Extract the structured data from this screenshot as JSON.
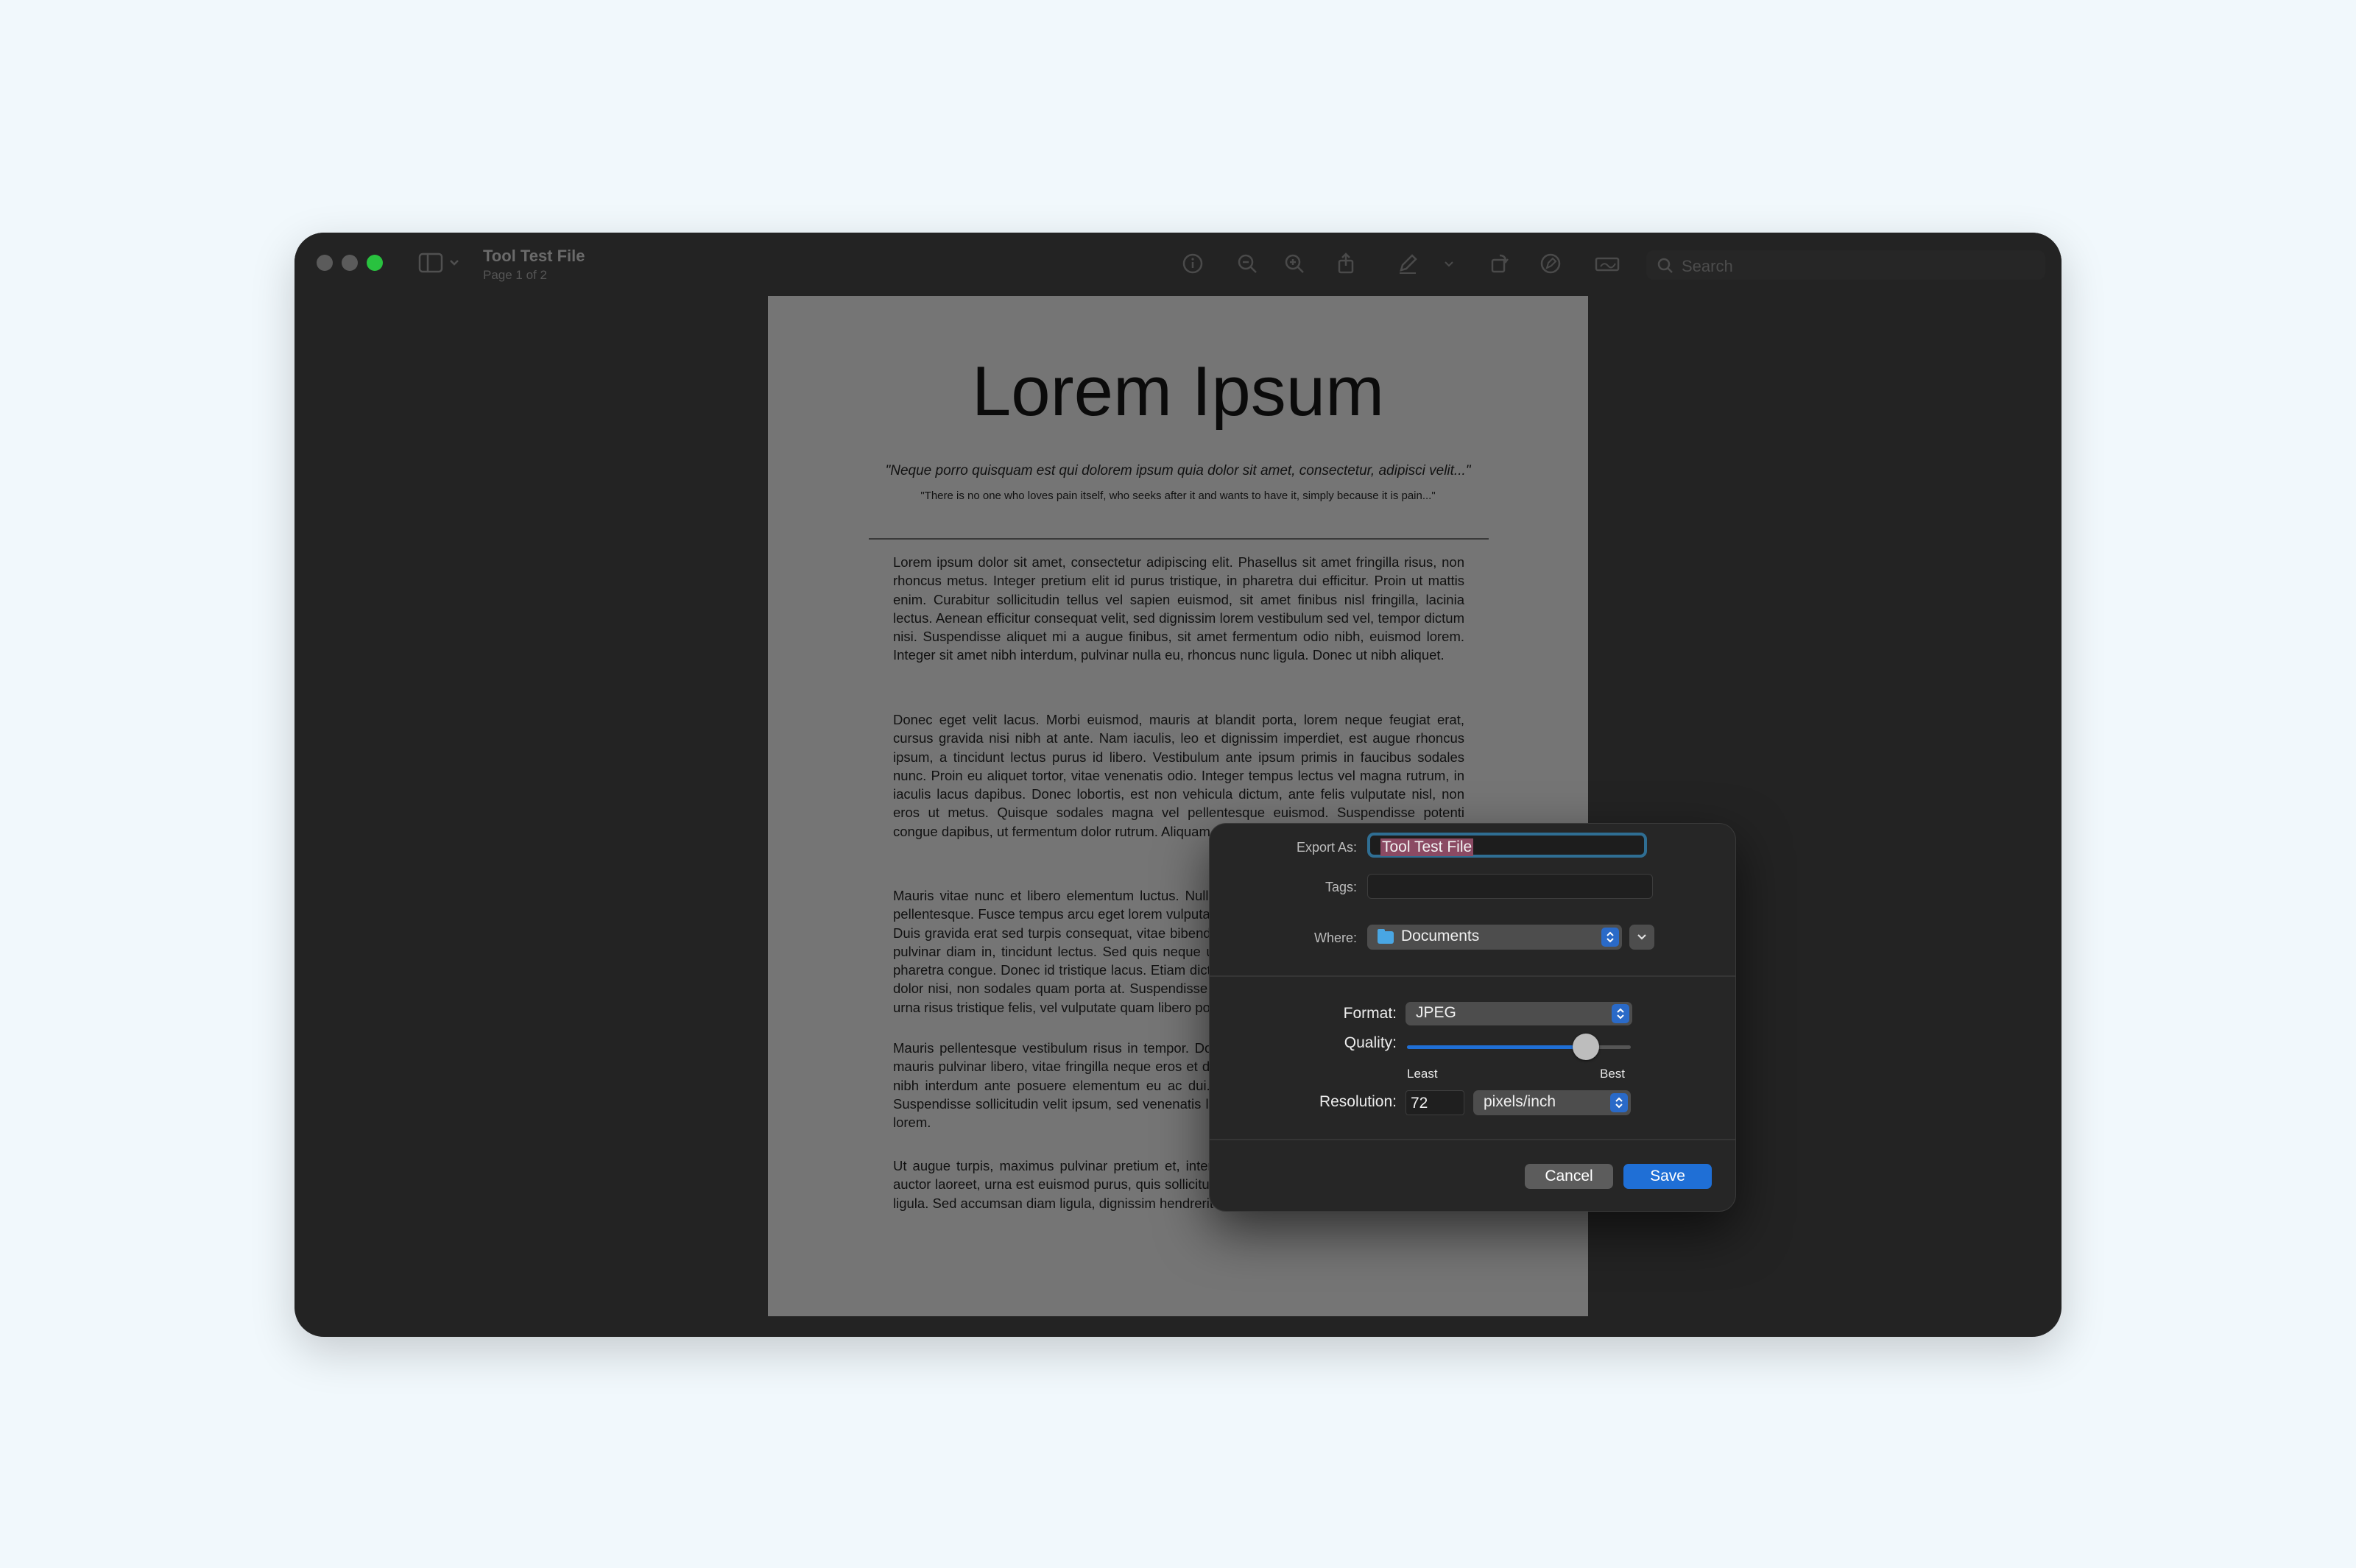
{
  "window": {
    "title": "Tool Test File",
    "subtitle": "Page 1 of 2",
    "search_placeholder": "Search",
    "toolbar_icons": [
      "info-icon",
      "zoom-out-icon",
      "zoom-in-icon",
      "share-icon",
      "markup-pen-icon",
      "chevron-down-icon",
      "rotate-icon",
      "highlight-circle-icon",
      "sign-icon",
      "search-icon"
    ]
  },
  "document": {
    "heading": "Lorem Ipsum",
    "quote": "\"Neque porro quisquam est qui dolorem ipsum quia dolor sit amet, consectetur, adipisci velit...\"",
    "quote_translation": "\"There is no one who loves pain itself, who seeks after it and wants to have it, simply because it is pain...\"",
    "paragraphs": [
      "Lorem ipsum dolor sit amet, consectetur adipiscing elit. Phasellus sit amet fringilla risus, non rhoncus metus. Integer pretium elit id purus tristique, in pharetra dui efficitur. Proin ut mattis enim. Curabitur sollicitudin tellus vel sapien euismod, sit amet finibus nisl fringilla, lacinia lectus. Aenean efficitur consequat velit, sed dignissim lorem vestibulum sed vel, tempor dictum nisi. Suspendisse aliquet mi a augue finibus, sit amet fermentum odio nibh, euismod lorem. Integer sit amet nibh interdum, pulvinar nulla eu, rhoncus nunc ligula. Donec ut nibh aliquet.",
      "Donec eget velit lacus. Morbi euismod, mauris at blandit porta, lorem neque feugiat erat, cursus gravida nisi nibh at ante. Nam iaculis, leo et dignissim imperdiet, est augue rhoncus ipsum, a tincidunt lectus purus id libero. Vestibulum ante ipsum primis in faucibus sodales nunc. Proin eu aliquet tortor, vitae venenatis odio. Integer tempus lectus vel magna rutrum, in iaculis lacus dapibus. Donec lobortis, est non vehicula dictum, ante felis vulputate nisl, non eros ut metus. Quisque sodales magna vel pellentesque euismod. Suspendisse potenti congue dapibus, ut fermentum dolor rutrum. Aliquam erat volutpat.",
      "Mauris vitae nunc et libero elementum luctus. Nulla facilisi. Cras pharetra sapien vel mollis pellentesque. Fusce tempus arcu eget lorem vulputate, at ultrices neque tempor. Sed ut mollis. Duis gravida erat sed turpis consequat, vitae bibendum nisl viverra. Praesent lobortis arcu ac, pulvinar diam in, tincidunt lectus. Sed quis neque ut urna porttitor consequat quis et viverra pharetra congue. Donec id tristique lacus. Etiam dictum nunc sit amet ex viverra, nec pharetra dolor nisi, non sodales quam porta at. Suspendisse sollicitudin, lorem vel congue elementum, urna risus tristique felis, vel vulputate quam libero porttitor turpis.",
      "Mauris pellentesque vestibulum risus in tempor. Donec mollis, ligula in pulvinar auctor, urna mauris pulvinar libero, vitae fringilla neque eros et dui. Morbi nec pretium elit. Integer sit amet nibh interdum ante posuere elementum eu ac dui. Ut eu bibendum ligula, ac lobortis felis. Suspendisse sollicitudin velit ipsum, sed venenatis lectus dignissim vitae. Curabitur eu blandit lorem.",
      "Ut augue turpis, maximus pulvinar pretium et, interdum at est. Vestibulum cursus, elit vitae auctor laoreet, urna est euismod purus, quis sollicitudin eros justo id augue. Sed ut fermentum ligula. Sed accumsan diam ligula, dignissim hendrerit ex dapibus nec. Cras non"
    ]
  },
  "export_dialog": {
    "export_as_label": "Export As:",
    "export_as_value": "Tool Test File",
    "tags_label": "Tags:",
    "tags_value": "",
    "where_label": "Where:",
    "where_value": "Documents",
    "format_label": "Format:",
    "format_value": "JPEG",
    "quality_label": "Quality:",
    "quality_level": 0.8,
    "quality_min_label": "Least",
    "quality_max_label": "Best",
    "resolution_label": "Resolution:",
    "resolution_value": "72",
    "resolution_unit": "pixels/inch",
    "cancel_label": "Cancel",
    "save_label": "Save",
    "accent_color": "#1f6fd6"
  }
}
